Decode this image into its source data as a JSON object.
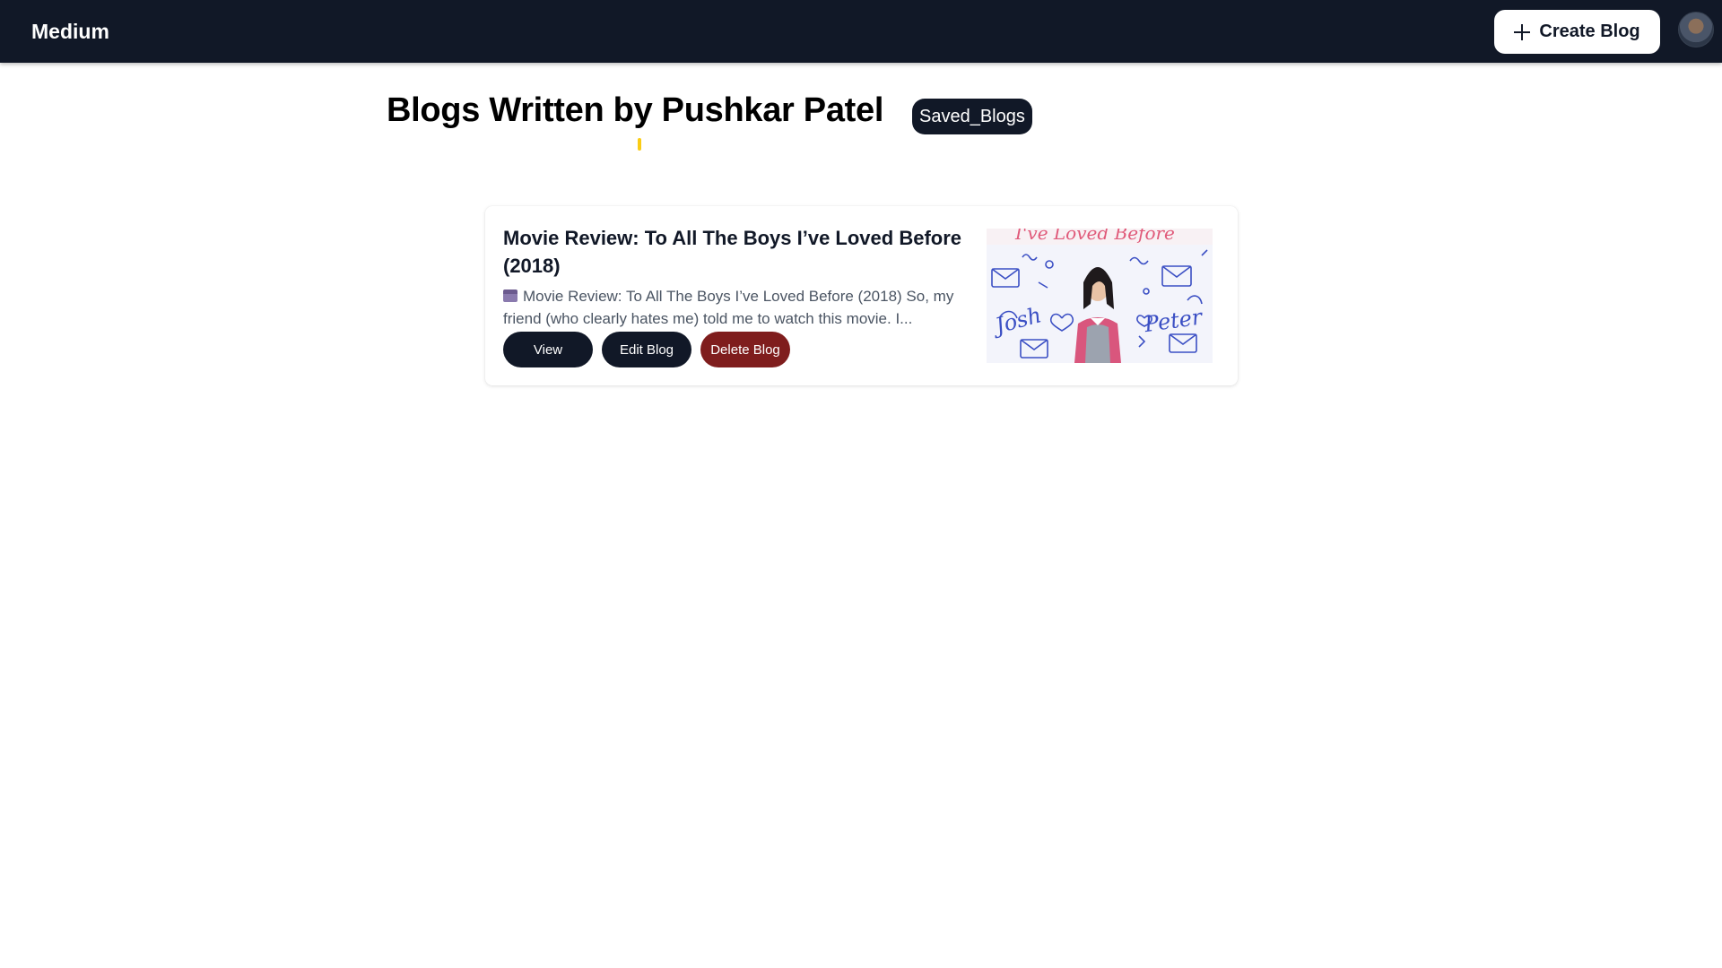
{
  "navbar": {
    "brand": "Medium",
    "create_label": "Create Blog"
  },
  "page": {
    "title": "Blogs Written by Pushkar Patel",
    "saved_badge": "Saved_Blogs"
  },
  "blogs": [
    {
      "title": "Movie Review: To All The Boys I’ve Loved Before (2018)",
      "excerpt": "Movie Review: To All The Boys I’ve Loved Before (2018) So, my friend (who clearly hates me) told me to watch this movie. I...",
      "view_label": "View",
      "edit_label": "Edit Blog",
      "delete_label": "Delete Blog",
      "image": {
        "header_text": "I've Loved Before",
        "left_script": "Josh",
        "right_script": "Peter"
      }
    }
  ],
  "colors": {
    "navbar_bg": "#111827",
    "button_dark": "#111827",
    "button_delete": "#7f1d1d",
    "image_accent": "#e05a7a",
    "doodle_blue": "#3b4fc4"
  },
  "icons": {
    "create": "plus-icon",
    "excerpt_prefix": "clapper-board-icon"
  }
}
